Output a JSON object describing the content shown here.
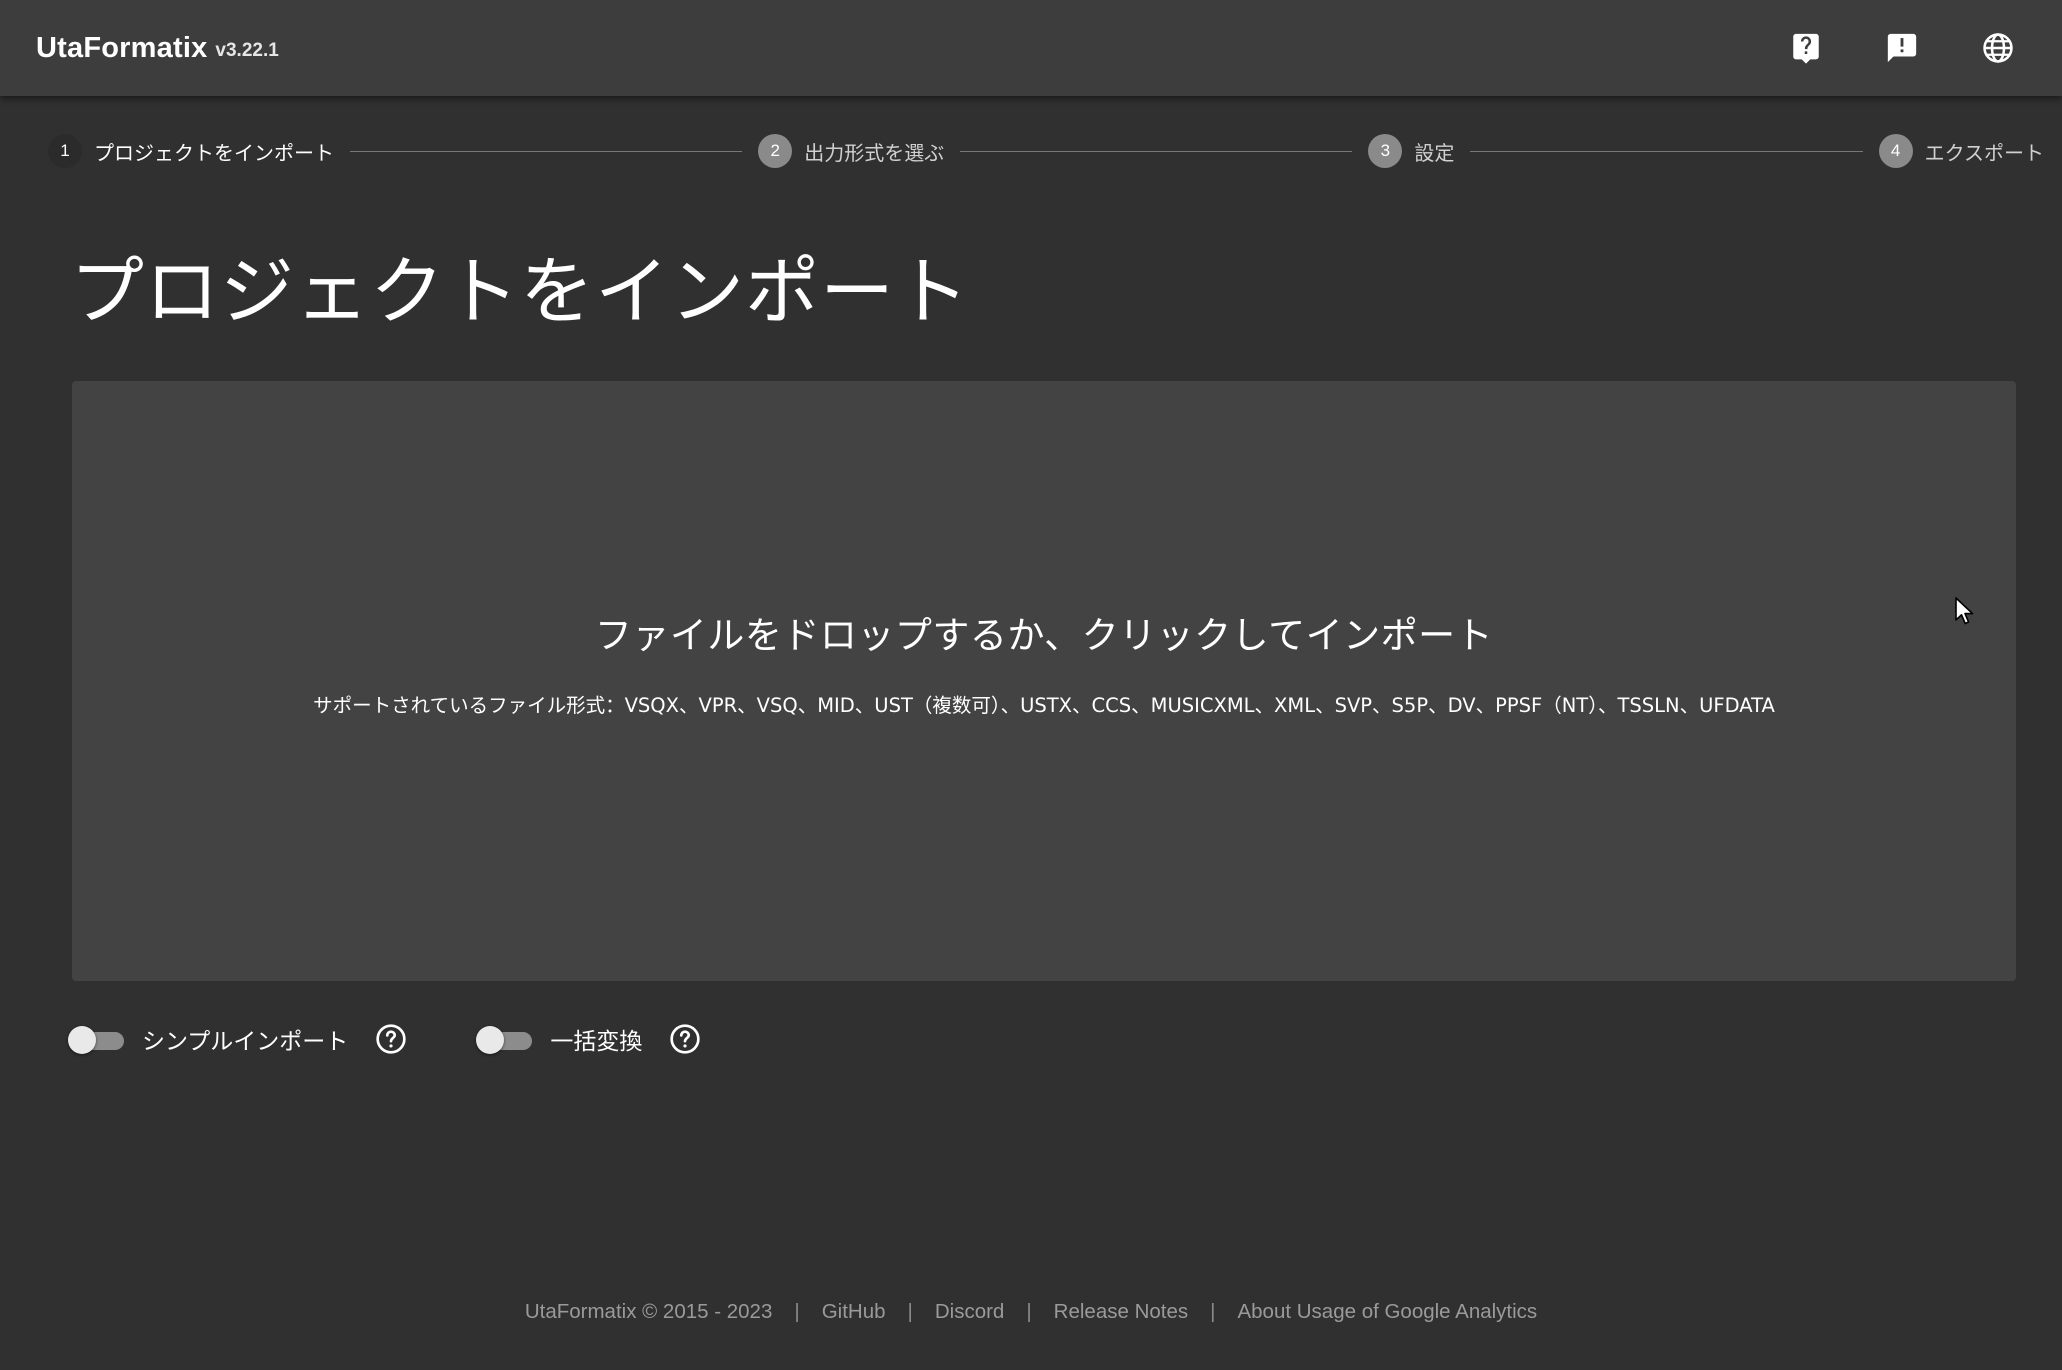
{
  "app": {
    "title": "UtaFormatix",
    "version": "v3.22.1",
    "icons": [
      "help-icon",
      "feedback-icon",
      "language-icon"
    ]
  },
  "stepper": {
    "steps": [
      {
        "number": "1",
        "label": "プロジェクトをインポート",
        "state": "active"
      },
      {
        "number": "2",
        "label": "出力形式を選ぶ",
        "state": "inactive"
      },
      {
        "number": "3",
        "label": "設定",
        "state": "inactive"
      },
      {
        "number": "4",
        "label": "エクスポート",
        "state": "inactive"
      }
    ]
  },
  "main": {
    "page_title": "プロジェクトをインポート",
    "dropzone": {
      "title": "ファイルをドロップするか、クリックしてインポート",
      "supported": "サポートされているファイル形式：VSQX、VPR、VSQ、MID、UST（複数可）、USTX、CCS、MUSICXML、XML、SVP、S5P、DV、PPSF（NT）、TSSLN、UFDATA"
    },
    "options": [
      {
        "label": "シンプルインポート",
        "checked": false,
        "icon": "help-circle-icon"
      },
      {
        "label": "一括変換",
        "checked": false,
        "icon": "help-circle-icon"
      }
    ]
  },
  "footer": {
    "copyright": "UtaFormatix © 2015 - 2023",
    "separator": "|",
    "links": [
      "GitHub",
      "Discord",
      "Release Notes",
      "About Usage of Google Analytics"
    ]
  },
  "colors": {
    "background": "#303030",
    "appbar": "#3d3d3d",
    "dropzone": "#434343",
    "step_inactive": "#8a8a8a",
    "footer_text": "#9a9a9a"
  }
}
